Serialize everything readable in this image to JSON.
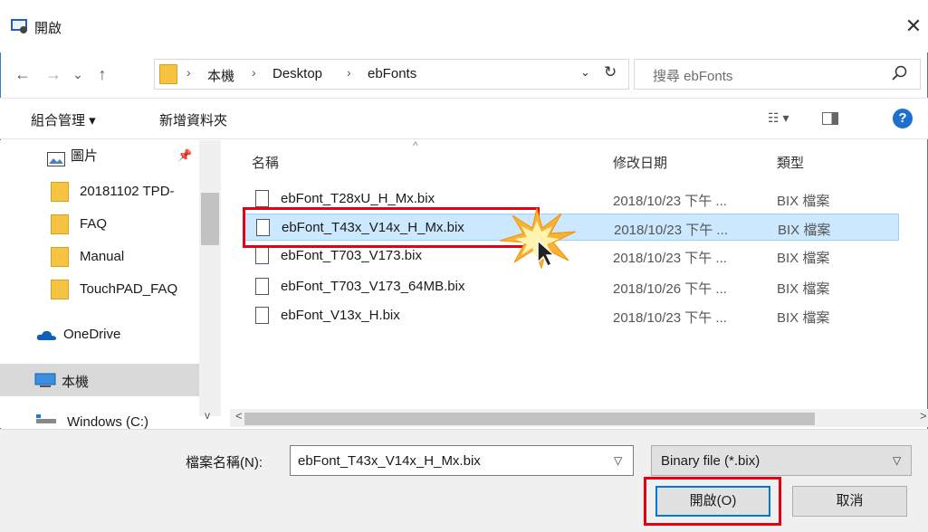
{
  "window": {
    "title": "開啟",
    "close_glyph": "✕"
  },
  "nav": {
    "back": "←",
    "forward": "→",
    "recent": "⌄",
    "up": "↑"
  },
  "breadcrumb": [
    "本機",
    "Desktop",
    "ebFonts"
  ],
  "breadcrumb_sep": "›",
  "address_dropdown": "⌄",
  "refresh_glyph": "↻",
  "search": {
    "placeholder": "搜尋 ebFonts"
  },
  "toolbar": {
    "organize": "組合管理 ▾",
    "new_folder": "新增資料夾",
    "view": "☷ ▾",
    "help": "?"
  },
  "navpane": {
    "items": [
      {
        "label": "圖片",
        "icon": "pictures-icon"
      },
      {
        "label": "20181102 TPD-",
        "icon": "folder-icon"
      },
      {
        "label": "FAQ",
        "icon": "folder-icon"
      },
      {
        "label": "Manual",
        "icon": "folder-icon"
      },
      {
        "label": "TouchPAD_FAQ",
        "icon": "folder-icon"
      },
      {
        "label": "OneDrive",
        "icon": "onedrive-icon"
      },
      {
        "label": "本機",
        "icon": "computer-icon"
      },
      {
        "label": "Windows (C:)",
        "icon": "drive-icon"
      }
    ]
  },
  "columns": {
    "name": "名稱",
    "date": "修改日期",
    "type": "類型"
  },
  "files": [
    {
      "name": "ebFont_T28xU_H_Mx.bix",
      "date": "2018/10/23 下午 ...",
      "type": "BIX 檔案"
    },
    {
      "name": "ebFont_T43x_V14x_H_Mx.bix",
      "date": "2018/10/23 下午 ...",
      "type": "BIX 檔案"
    },
    {
      "name": "ebFont_T703_V173.bix",
      "date": "2018/10/23 下午 ...",
      "type": "BIX 檔案"
    },
    {
      "name": "ebFont_T703_V173_64MB.bix",
      "date": "2018/10/26 下午 ...",
      "type": "BIX 檔案"
    },
    {
      "name": "ebFont_V13x_H.bix",
      "date": "2018/10/23 下午 ...",
      "type": "BIX 檔案"
    }
  ],
  "filename": {
    "label": "檔案名稱(N):",
    "value": "ebFont_T43x_V14x_H_Mx.bix"
  },
  "filter": {
    "value": "Binary file (*.bix)"
  },
  "buttons": {
    "open": "開啟(O)",
    "cancel": "取消"
  },
  "colors": {
    "accent": "#0078d7",
    "highlight_red": "#e60012",
    "selection": "#cce8ff"
  }
}
